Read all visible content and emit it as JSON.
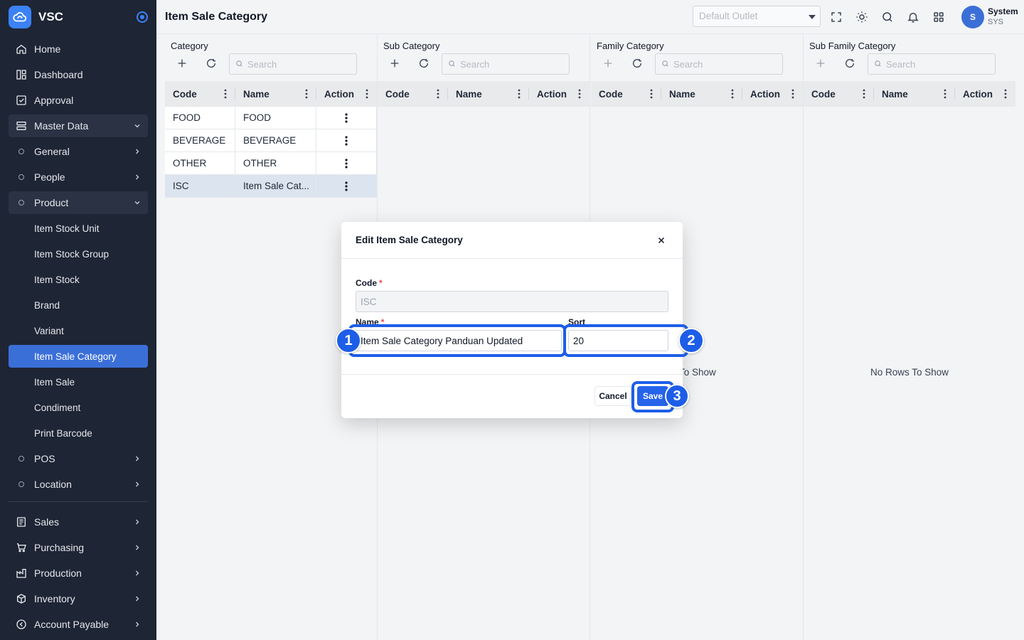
{
  "app": {
    "name": "VSC"
  },
  "header": {
    "title": "Item Sale Category",
    "outlet_placeholder": "Default Outlet",
    "user": {
      "initial": "S",
      "name": "System",
      "code": "SYS"
    }
  },
  "sidebar": {
    "items": [
      {
        "label": "Home",
        "icon": "home-icon"
      },
      {
        "label": "Dashboard",
        "icon": "dashboard-icon"
      },
      {
        "label": "Approval",
        "icon": "approval-icon"
      },
      {
        "label": "Master Data",
        "icon": "database-icon"
      },
      {
        "label": "General"
      },
      {
        "label": "People"
      },
      {
        "label": "Product"
      },
      {
        "label": "Item Stock Unit"
      },
      {
        "label": "Item Stock Group"
      },
      {
        "label": "Item Stock"
      },
      {
        "label": "Brand"
      },
      {
        "label": "Variant"
      },
      {
        "label": "Item Sale Category"
      },
      {
        "label": "Item Sale"
      },
      {
        "label": "Condiment"
      },
      {
        "label": "Print Barcode"
      },
      {
        "label": "POS"
      },
      {
        "label": "Location"
      },
      {
        "label": "Sales",
        "icon": "sales-icon"
      },
      {
        "label": "Purchasing",
        "icon": "cart-icon"
      },
      {
        "label": "Production",
        "icon": "factory-icon"
      },
      {
        "label": "Inventory",
        "icon": "box-icon"
      },
      {
        "label": "Account Payable",
        "icon": "payable-icon"
      }
    ]
  },
  "panels": [
    {
      "title": "Category",
      "search_placeholder": "Search",
      "columns": [
        "Code",
        "Name",
        "Action"
      ],
      "rows": [
        {
          "code": "FOOD",
          "name": "FOOD"
        },
        {
          "code": "BEVERAGE",
          "name": "BEVERAGE"
        },
        {
          "code": "OTHER",
          "name": "OTHER"
        },
        {
          "code": "ISC",
          "name": "Item Sale Cat..."
        }
      ]
    },
    {
      "title": "Sub Category",
      "search_placeholder": "Search",
      "columns": [
        "Code",
        "Name",
        "Action"
      ],
      "empty": ""
    },
    {
      "title": "Family Category",
      "search_placeholder": "Search",
      "columns": [
        "Code",
        "Name",
        "Action"
      ],
      "empty": "ws To Show"
    },
    {
      "title": "Sub Family Category",
      "search_placeholder": "Search",
      "columns": [
        "Code",
        "Name",
        "Action"
      ],
      "empty": "No Rows To Show"
    }
  ],
  "modal": {
    "title": "Edit Item Sale Category",
    "code_label": "Code",
    "code_value": "ISC",
    "name_label": "Name",
    "name_value": "Item Sale Category Panduan Updated",
    "sort_label": "Sort",
    "sort_value": "20",
    "required_mark": "*",
    "cancel_label": "Cancel",
    "save_label": "Save"
  },
  "annotations": [
    "1",
    "2",
    "3"
  ]
}
